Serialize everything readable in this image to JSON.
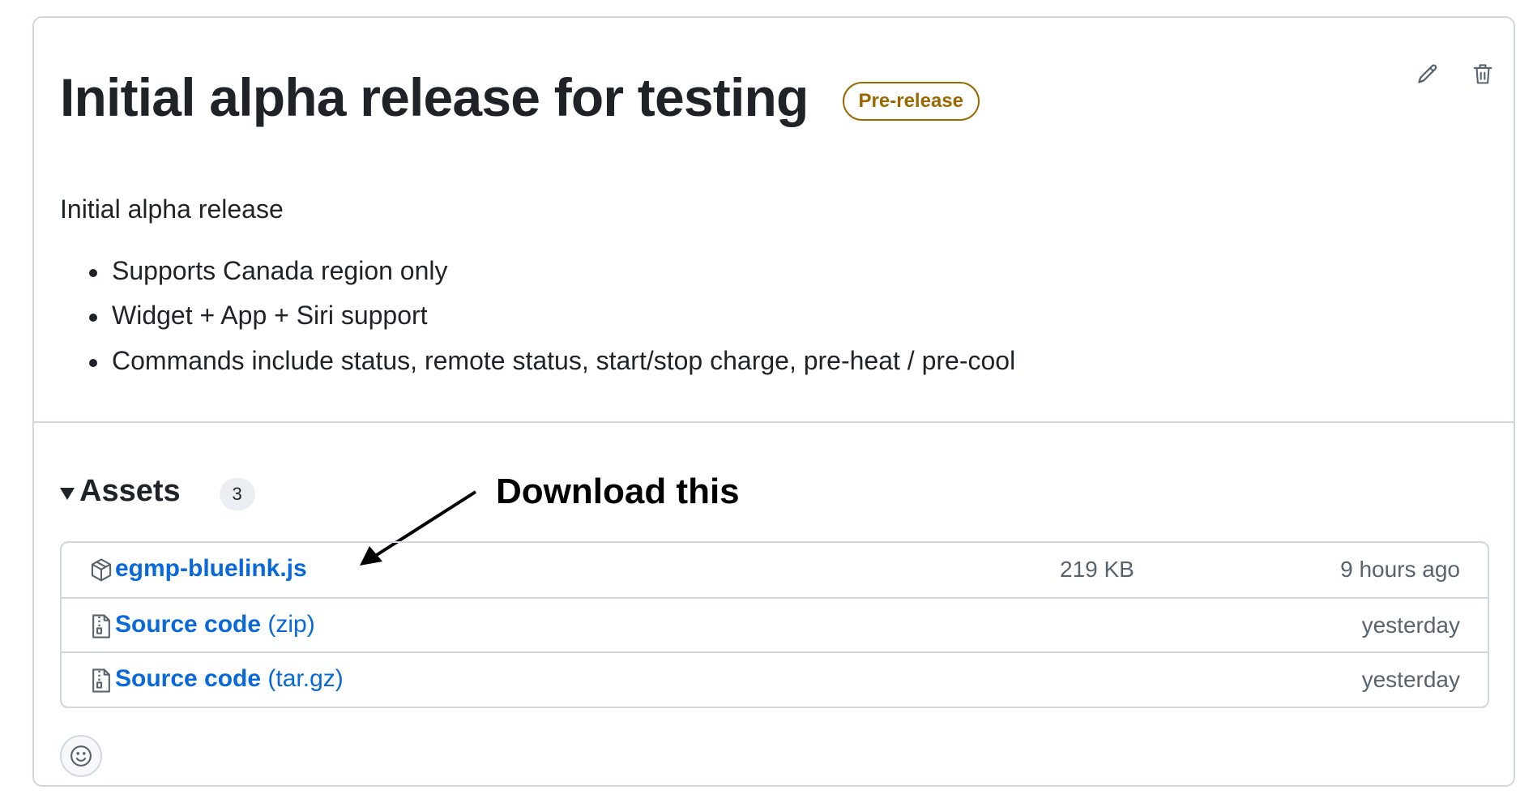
{
  "release": {
    "title": "Initial alpha release for testing",
    "badge": "Pre-release",
    "body": {
      "intro": "Initial alpha release",
      "bullets": [
        "Supports Canada region only",
        "Widget + App + Siri support",
        "Commands include status, remote status, start/stop charge, pre-heat / pre-cool"
      ]
    },
    "actions": {
      "edit_icon": "pencil-icon",
      "delete_icon": "trash-icon"
    }
  },
  "assets": {
    "label": "Assets",
    "count": "3",
    "annotation": "Download this",
    "items": [
      {
        "icon": "package-icon",
        "name": "egmp-bluelink.js",
        "ext": "",
        "size": "219 KB",
        "date": "9 hours ago"
      },
      {
        "icon": "file-zip-icon",
        "name": "Source code",
        "ext": "(zip)",
        "size": "",
        "date": "yesterday"
      },
      {
        "icon": "file-zip-icon",
        "name": "Source code",
        "ext": "(tar.gz)",
        "size": "",
        "date": "yesterday"
      }
    ]
  },
  "reactions": {
    "icon": "smiley-icon"
  },
  "colors": {
    "link": "#0969da",
    "badge": "#9a6700",
    "border": "#d0d7de",
    "muted": "#59636e"
  }
}
